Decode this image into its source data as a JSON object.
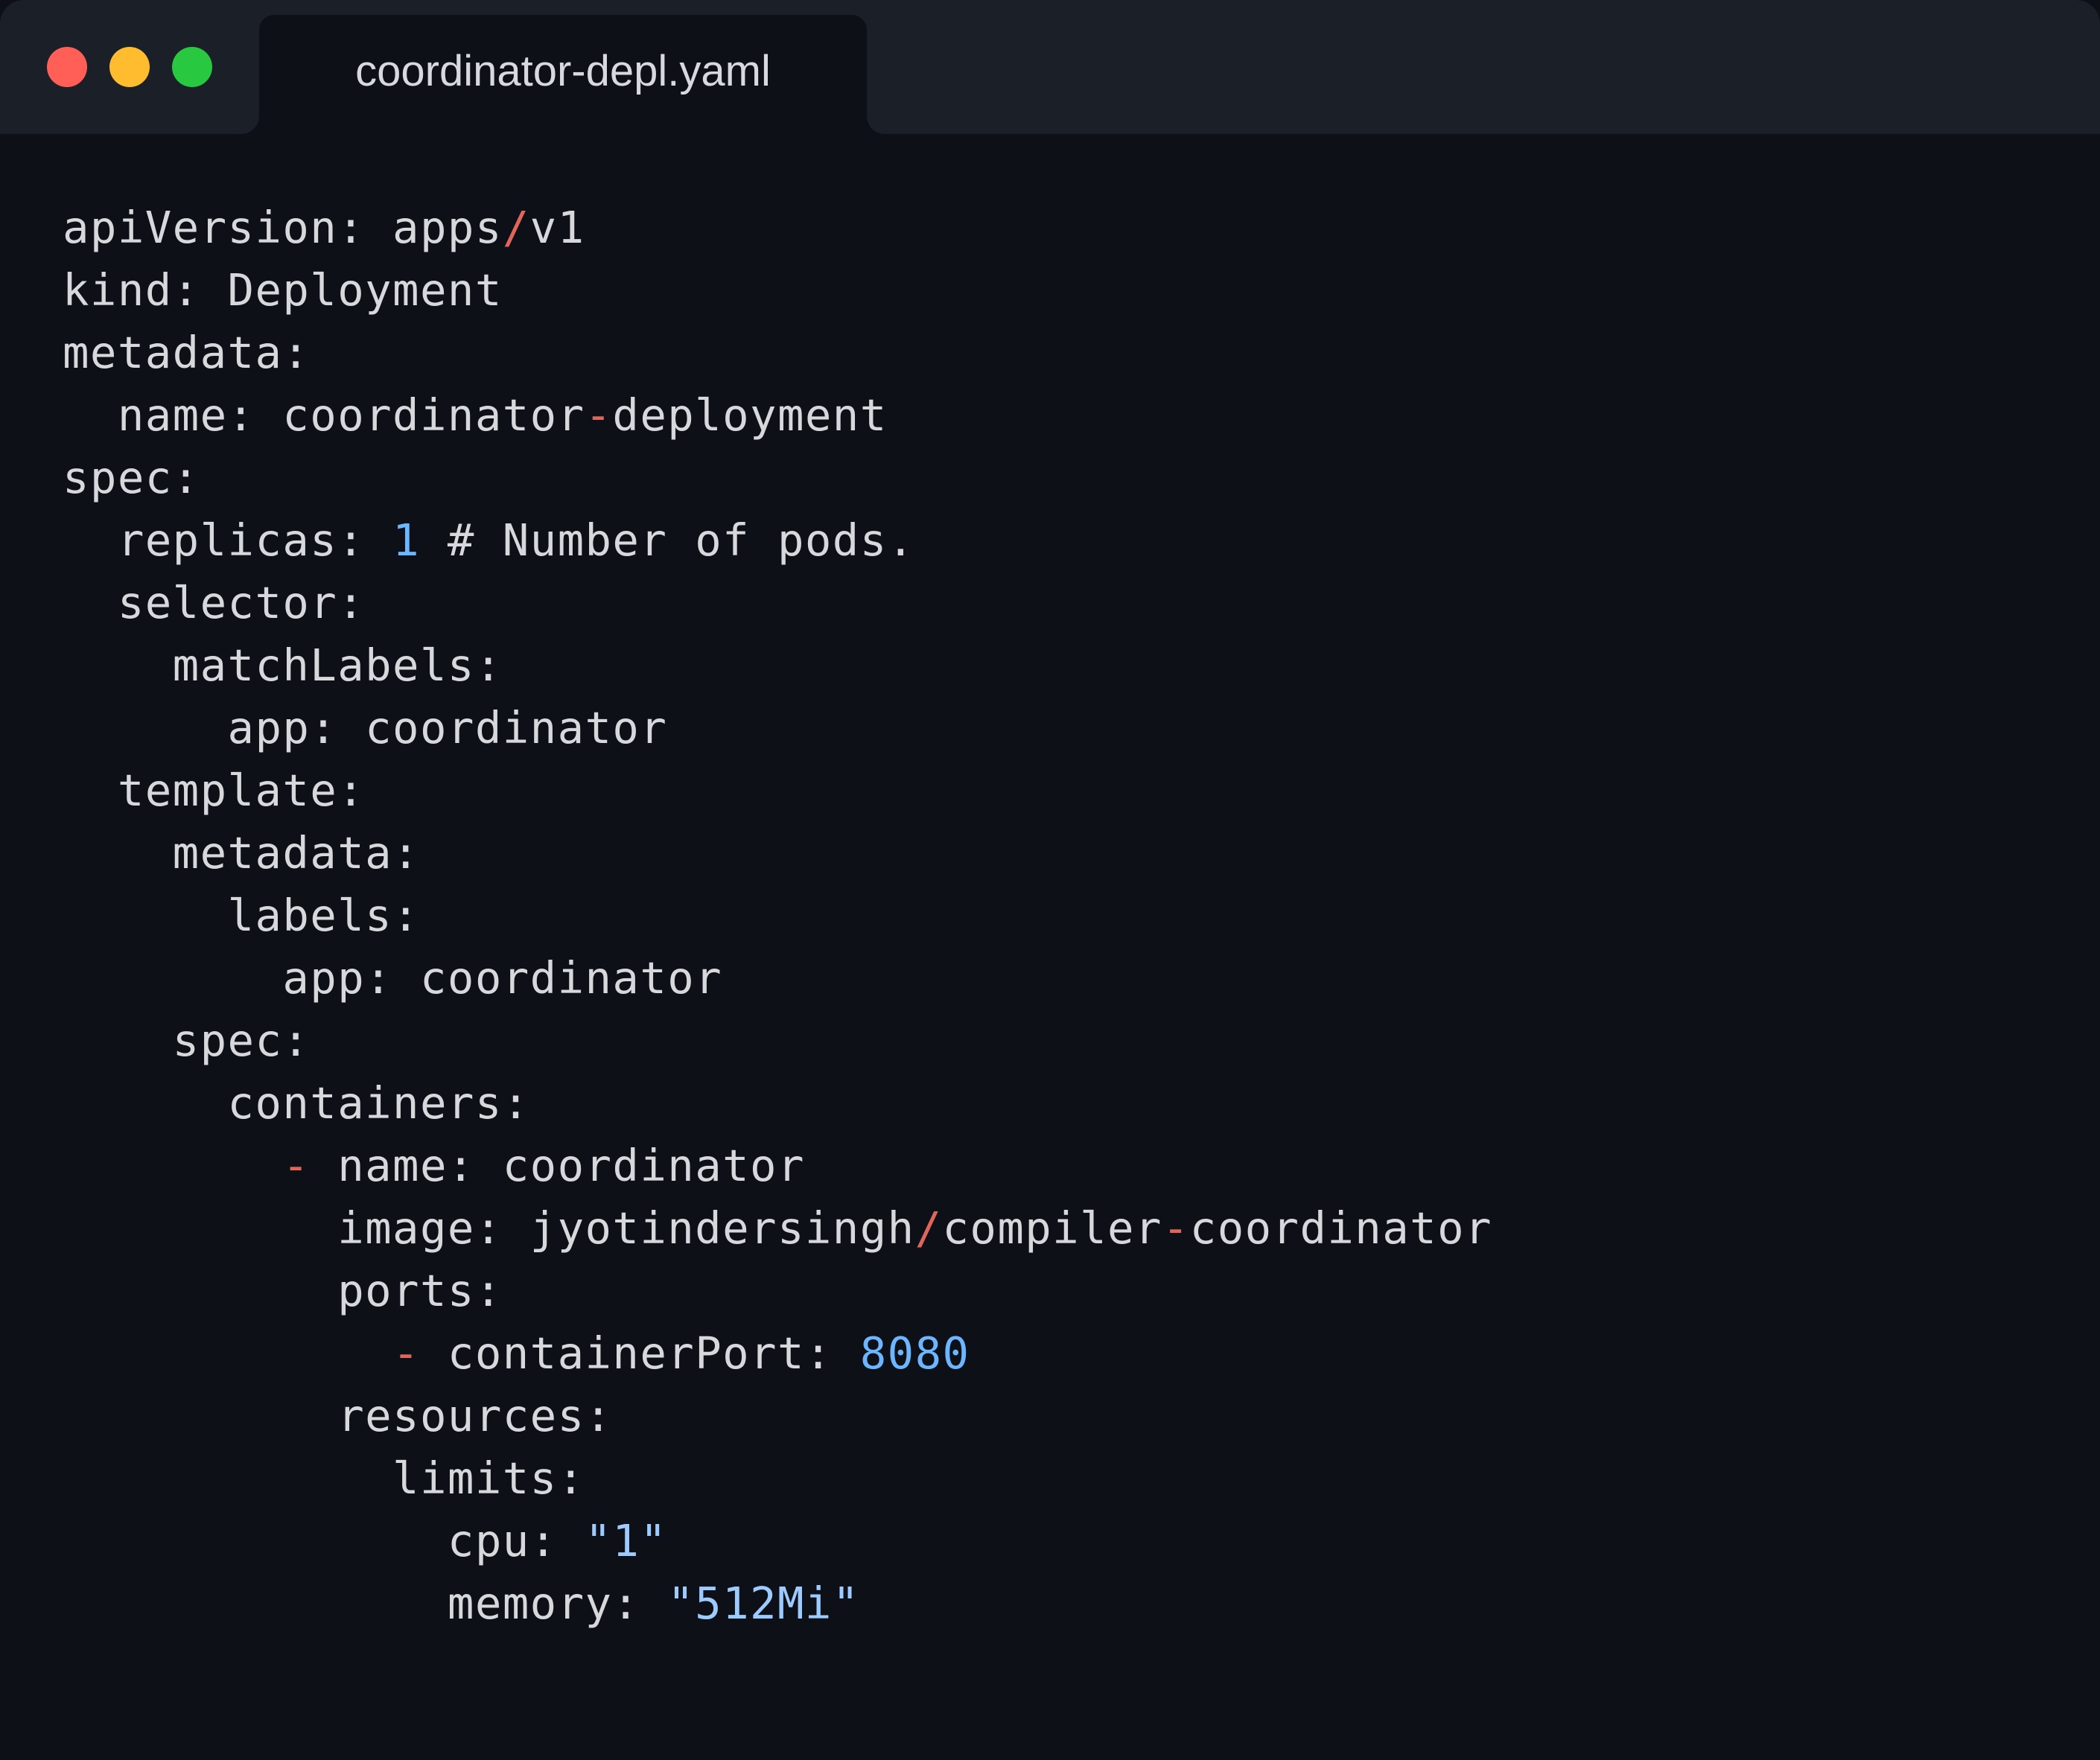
{
  "window": {
    "title": "coordinator-depl.yaml",
    "controls": [
      {
        "name": "close",
        "color": "#ff5f57"
      },
      {
        "name": "minimize",
        "color": "#febc2e"
      },
      {
        "name": "maximize",
        "color": "#28c840"
      }
    ]
  },
  "theme": {
    "background": "#0d1017",
    "titlebar": "#1b1f27",
    "text": "#d6d8dc",
    "punctuation": "#e0665c",
    "number": "#6cb6ff",
    "string": "#9ecbff"
  },
  "code": {
    "language": "yaml",
    "lines": [
      [
        {
          "t": "apiVersion: apps",
          "k": "text"
        },
        {
          "t": "/",
          "k": "punct"
        },
        {
          "t": "v1",
          "k": "text"
        }
      ],
      [
        {
          "t": "kind: Deployment",
          "k": "text"
        }
      ],
      [
        {
          "t": "metadata:",
          "k": "text"
        }
      ],
      [
        {
          "t": "  name: coordinator",
          "k": "text"
        },
        {
          "t": "-",
          "k": "punct"
        },
        {
          "t": "deployment",
          "k": "text"
        }
      ],
      [
        {
          "t": "spec:",
          "k": "text"
        }
      ],
      [
        {
          "t": "  replicas: ",
          "k": "text"
        },
        {
          "t": "1",
          "k": "number"
        },
        {
          "t": " # Number of pods.",
          "k": "text"
        }
      ],
      [
        {
          "t": "  selector:",
          "k": "text"
        }
      ],
      [
        {
          "t": "    matchLabels:",
          "k": "text"
        }
      ],
      [
        {
          "t": "      app: coordinator",
          "k": "text"
        }
      ],
      [
        {
          "t": "  template:",
          "k": "text"
        }
      ],
      [
        {
          "t": "    metadata:",
          "k": "text"
        }
      ],
      [
        {
          "t": "      labels:",
          "k": "text"
        }
      ],
      [
        {
          "t": "        app: coordinator",
          "k": "text"
        }
      ],
      [
        {
          "t": "    spec:",
          "k": "text"
        }
      ],
      [
        {
          "t": "      containers:",
          "k": "text"
        }
      ],
      [
        {
          "t": "        ",
          "k": "text"
        },
        {
          "t": "-",
          "k": "punct"
        },
        {
          "t": " name: coordinator",
          "k": "text"
        }
      ],
      [
        {
          "t": "          image: jyotindersingh",
          "k": "text"
        },
        {
          "t": "/",
          "k": "punct"
        },
        {
          "t": "compiler",
          "k": "text"
        },
        {
          "t": "-",
          "k": "punct"
        },
        {
          "t": "coordinator",
          "k": "text"
        }
      ],
      [
        {
          "t": "          ports:",
          "k": "text"
        }
      ],
      [
        {
          "t": "            ",
          "k": "text"
        },
        {
          "t": "-",
          "k": "punct"
        },
        {
          "t": " containerPort: ",
          "k": "text"
        },
        {
          "t": "8080",
          "k": "number"
        }
      ],
      [
        {
          "t": "          resources:",
          "k": "text"
        }
      ],
      [
        {
          "t": "            limits:",
          "k": "text"
        }
      ],
      [
        {
          "t": "              cpu: ",
          "k": "text"
        },
        {
          "t": "\"1\"",
          "k": "string"
        }
      ],
      [
        {
          "t": "              memory: ",
          "k": "text"
        },
        {
          "t": "\"512Mi\"",
          "k": "string"
        }
      ]
    ]
  }
}
